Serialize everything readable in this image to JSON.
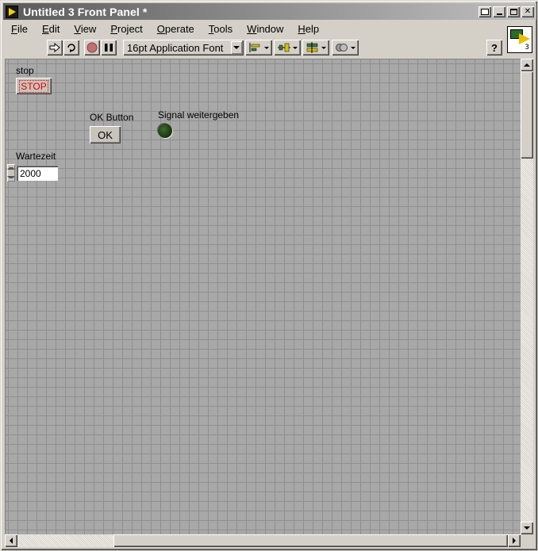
{
  "window": {
    "title": "Untitled 3 Front Panel *"
  },
  "menu": [
    {
      "label": "File",
      "accel": "F",
      "rest": "ile"
    },
    {
      "label": "Edit",
      "accel": "E",
      "rest": "dit"
    },
    {
      "label": "View",
      "accel": "V",
      "rest": "iew"
    },
    {
      "label": "Project",
      "accel": "P",
      "rest": "roject"
    },
    {
      "label": "Operate",
      "accel": "O",
      "rest": "perate"
    },
    {
      "label": "Tools",
      "accel": "T",
      "rest": "ools"
    },
    {
      "label": "Window",
      "accel": "W",
      "rest": "indow"
    },
    {
      "label": "Help",
      "accel": "H",
      "rest": "elp"
    }
  ],
  "toolbar": {
    "font_select": "16pt Application Font",
    "help_label": "?",
    "tools": [
      "run-icon",
      "run-continuously-icon",
      "abort-icon",
      "pause-icon",
      "align-objects-icon",
      "distribute-objects-icon",
      "resize-objects-icon",
      "reorder-icon"
    ]
  },
  "vi_icon": {
    "number": "3"
  },
  "panel": {
    "stop": {
      "label": "stop",
      "button_text": "STOP",
      "text_color": "#e00000"
    },
    "ok": {
      "label": "OK Button",
      "button_text": "OK"
    },
    "led": {
      "label": "Signal weitergeben",
      "state": "off",
      "color": "#1c3a14"
    },
    "numeric": {
      "label": "Wartezeit",
      "value": "2000"
    }
  }
}
